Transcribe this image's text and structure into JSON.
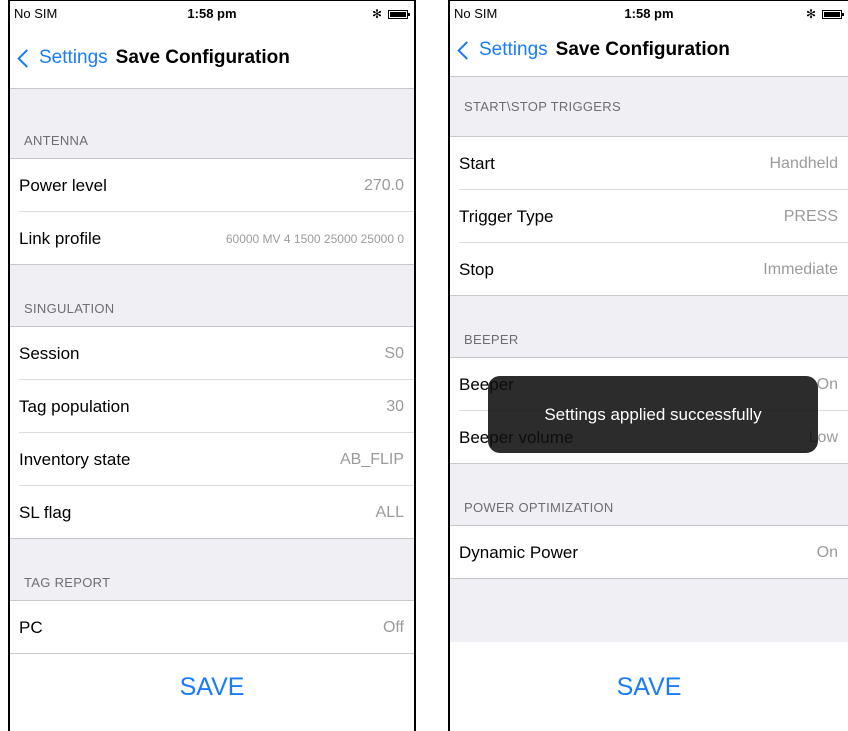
{
  "left": {
    "status": {
      "carrier": "No SIM",
      "time": "1:58 pm",
      "bluetooth": "✻"
    },
    "nav": {
      "back_label": "Settings",
      "title": "Save Configuration"
    },
    "sections": [
      {
        "header": "ANTENNA",
        "rows": [
          {
            "label": "Power level",
            "value": "270.0"
          },
          {
            "label": "Link profile",
            "value": "60000 MV 4 1500 25000 25000 0"
          }
        ]
      },
      {
        "header": "SINGULATION",
        "rows": [
          {
            "label": "Session",
            "value": "S0"
          },
          {
            "label": "Tag population",
            "value": "30"
          },
          {
            "label": "Inventory state",
            "value": "AB_FLIP"
          },
          {
            "label": "SL flag",
            "value": "ALL"
          }
        ]
      },
      {
        "header": "TAG REPORT",
        "rows": [
          {
            "label": "PC",
            "value": "Off"
          }
        ]
      }
    ],
    "save_label": "SAVE"
  },
  "right": {
    "status": {
      "carrier": "No SIM",
      "time": "1:58 pm",
      "bluetooth": "✻"
    },
    "nav": {
      "back_label": "Settings",
      "title": "Save Configuration"
    },
    "sections": [
      {
        "header": "START\\STOP TRIGGERS",
        "rows": [
          {
            "label": "Start",
            "value": "Handheld"
          },
          {
            "label": "Trigger Type",
            "value": "PRESS"
          },
          {
            "label": "Stop",
            "value": "Immediate"
          }
        ]
      },
      {
        "header": "BEEPER",
        "rows": [
          {
            "label": "Beeper",
            "value": "On"
          },
          {
            "label": "Beeper volume",
            "value": "Low"
          }
        ]
      },
      {
        "header": "POWER OPTIMIZATION",
        "rows": [
          {
            "label": "Dynamic Power",
            "value": "On"
          }
        ]
      }
    ],
    "save_label": "SAVE",
    "toast": "Settings applied successfully"
  },
  "colors": {
    "accent": "#1a7cf5",
    "group_bg": "#efeff4",
    "value_text": "#9b9b9b",
    "toast_bg": "#0f0f0f"
  }
}
